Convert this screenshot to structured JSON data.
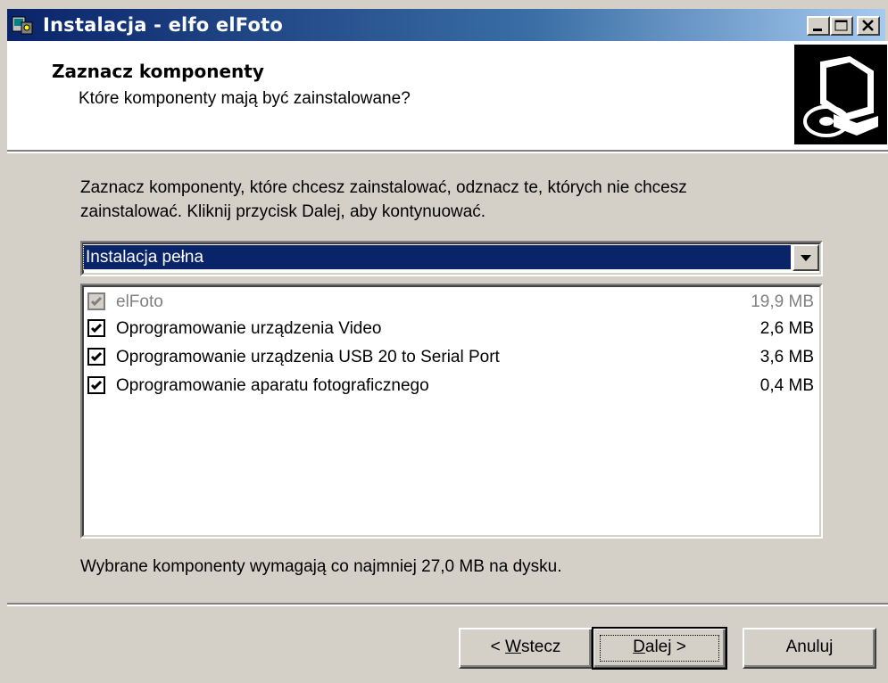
{
  "window": {
    "title": "Instalacja - elfo elFoto",
    "controls": [
      "minimize",
      "maximize",
      "close"
    ]
  },
  "header": {
    "title": "Zaznacz komponenty",
    "subtitle": "Które komponenty mają być zainstalowane?",
    "image_icon": "computer-cd-install-icon"
  },
  "body": {
    "description_line1": "Zaznacz komponenty, które chcesz zainstalować, odznacz te, których nie chcesz",
    "description_line2": "zainstalować. Kliknij przycisk Dalej, aby kontynuować.",
    "install_type": {
      "selected": "Instalacja pełna"
    },
    "components": [
      {
        "name": "elFoto",
        "size": "19,9 MB",
        "checked": true,
        "disabled": true
      },
      {
        "name": "Oprogramowanie urządzenia Video",
        "size": "2,6 MB",
        "checked": true,
        "disabled": false
      },
      {
        "name": "Oprogramowanie urządzenia USB 20 to Serial Port",
        "size": "3,6 MB",
        "checked": true,
        "disabled": false
      },
      {
        "name": "Oprogramowanie aparatu fotograficznego",
        "size": "0,4 MB",
        "checked": true,
        "disabled": false
      }
    ],
    "space_required": "Wybrane komponenty wymagają co najmniej 27,0 MB na dysku."
  },
  "buttons": {
    "back_prefix": "< ",
    "back_mnemonic": "W",
    "back_rest": "stecz",
    "next_mnemonic": "D",
    "next_rest": "alej >",
    "cancel": "Anuluj"
  }
}
